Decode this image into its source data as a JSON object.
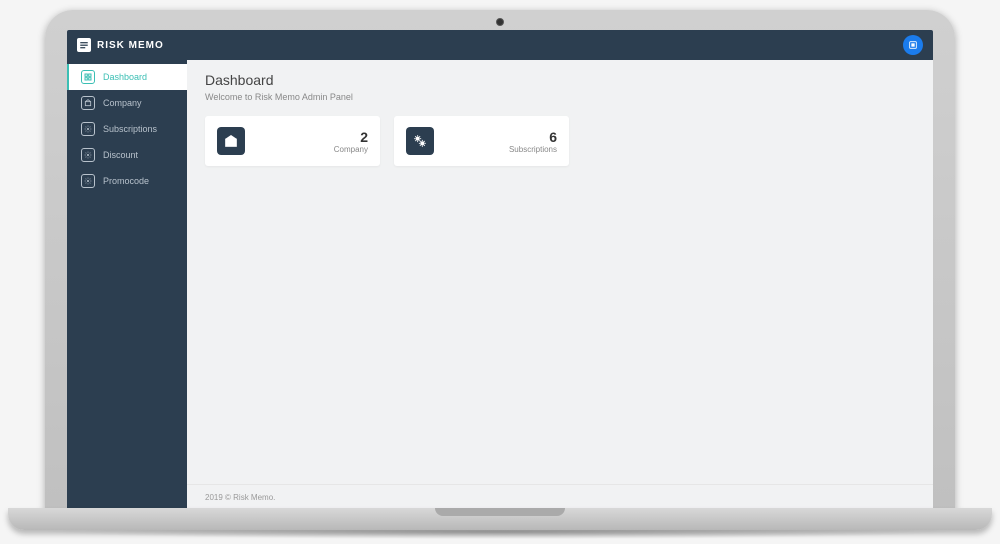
{
  "brand": {
    "name": "RISK MEMO"
  },
  "sidebar": {
    "items": [
      {
        "label": "Dashboard",
        "icon": "dashboard-icon",
        "active": true
      },
      {
        "label": "Company",
        "icon": "company-icon",
        "active": false
      },
      {
        "label": "Subscriptions",
        "icon": "gear-icon",
        "active": false
      },
      {
        "label": "Discount",
        "icon": "gear-icon",
        "active": false
      },
      {
        "label": "Promocode",
        "icon": "gear-icon",
        "active": false
      }
    ]
  },
  "page": {
    "title": "Dashboard",
    "subtitle": "Welcome to Risk Memo Admin Panel"
  },
  "stats": [
    {
      "value": "2",
      "label": "Company",
      "icon": "company-icon"
    },
    {
      "value": "6",
      "label": "Subscriptions",
      "icon": "gears-icon"
    }
  ],
  "footer": {
    "text": "2019 © Risk Memo."
  }
}
